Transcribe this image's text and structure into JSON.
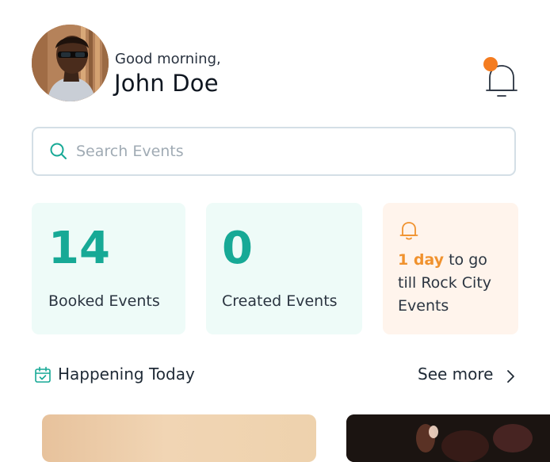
{
  "header": {
    "greeting": "Good morning,",
    "user_name": "John Doe",
    "avatar_icon": "user-avatar",
    "notification_icon": "bell-icon",
    "notification_dot_color": "#f47c20"
  },
  "search": {
    "placeholder": "Search Events",
    "value": "",
    "icon": "search-icon"
  },
  "stats": {
    "booked": {
      "value": "14",
      "label": "Booked Events"
    },
    "created": {
      "value": "0",
      "label": "Created Events"
    },
    "reminder": {
      "icon": "bell-icon",
      "highlight": "1 day",
      "rest": " to go till Rock City Events"
    }
  },
  "section": {
    "icon": "calendar-check-icon",
    "title": "Happening Today",
    "see_more": "See more",
    "see_more_icon": "chevron-right-icon"
  },
  "colors": {
    "accent_teal": "#17a996",
    "accent_orange": "#f0922e",
    "card_teal_bg": "#eefbf8",
    "card_orange_bg": "#fff4ec"
  }
}
